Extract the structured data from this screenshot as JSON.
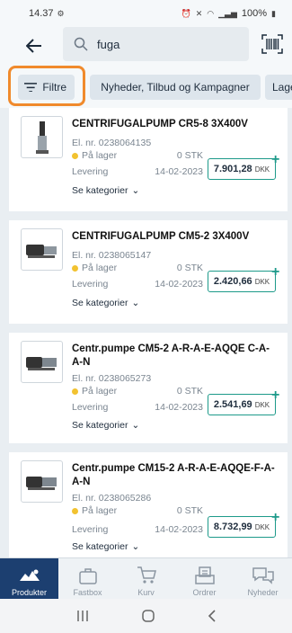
{
  "status_bar": {
    "time": "14.37",
    "battery": "100%"
  },
  "search": {
    "value": "fuga",
    "placeholder": ""
  },
  "filters": {
    "filter_label": "Filtre",
    "chips": [
      "Nyheder, Tilbud og Kampagner",
      "Lage"
    ]
  },
  "products": [
    {
      "name": "CENTRIFUGALPUMP CR5-8 3X400V",
      "el_nr": "El. nr. 0238064135",
      "stock_label": "På lager",
      "stock_qty": "0 STK",
      "delivery_label": "Levering",
      "delivery_date": "14-02-2023",
      "price": "7.901,28",
      "currency": "DKK",
      "categories_label": "Se kategorier"
    },
    {
      "name": "CENTRIFUGALPUMP CM5-2 3X400V",
      "el_nr": "El. nr. 0238065147",
      "stock_label": "På lager",
      "stock_qty": "0 STK",
      "delivery_label": "Levering",
      "delivery_date": "14-02-2023",
      "price": "2.420,66",
      "currency": "DKK",
      "categories_label": "Se kategorier"
    },
    {
      "name": "Centr.pumpe CM5-2 A-R-A-E-AQQE C-A-A-N",
      "el_nr": "El. nr. 0238065273",
      "stock_label": "På lager",
      "stock_qty": "0 STK",
      "delivery_label": "Levering",
      "delivery_date": "14-02-2023",
      "price": "2.541,69",
      "currency": "DKK",
      "categories_label": "Se kategorier"
    },
    {
      "name": "Centr.pumpe CM15-2 A-R-A-E-AQQE-F-A-A-N",
      "el_nr": "El. nr. 0238065286",
      "stock_label": "På lager",
      "stock_qty": "0 STK",
      "delivery_label": "Levering",
      "delivery_date": "14-02-2023",
      "price": "8.732,99",
      "currency": "DKK",
      "categories_label": "Se kategorier"
    }
  ],
  "bottom_nav": {
    "items": [
      {
        "label": "Produkter",
        "icon": "products-icon",
        "active": true
      },
      {
        "label": "Fastbox",
        "icon": "fastbox-icon",
        "active": false
      },
      {
        "label": "Kurv",
        "icon": "cart-icon",
        "active": false
      },
      {
        "label": "Ordrer",
        "icon": "orders-icon",
        "active": false
      },
      {
        "label": "Nyheder",
        "icon": "news-icon",
        "active": false
      }
    ]
  },
  "colors": {
    "accent": "#1d9a8a",
    "nav_active": "#1c3f70",
    "highlight": "#f08a2c",
    "stock_dot": "#f2c230"
  }
}
